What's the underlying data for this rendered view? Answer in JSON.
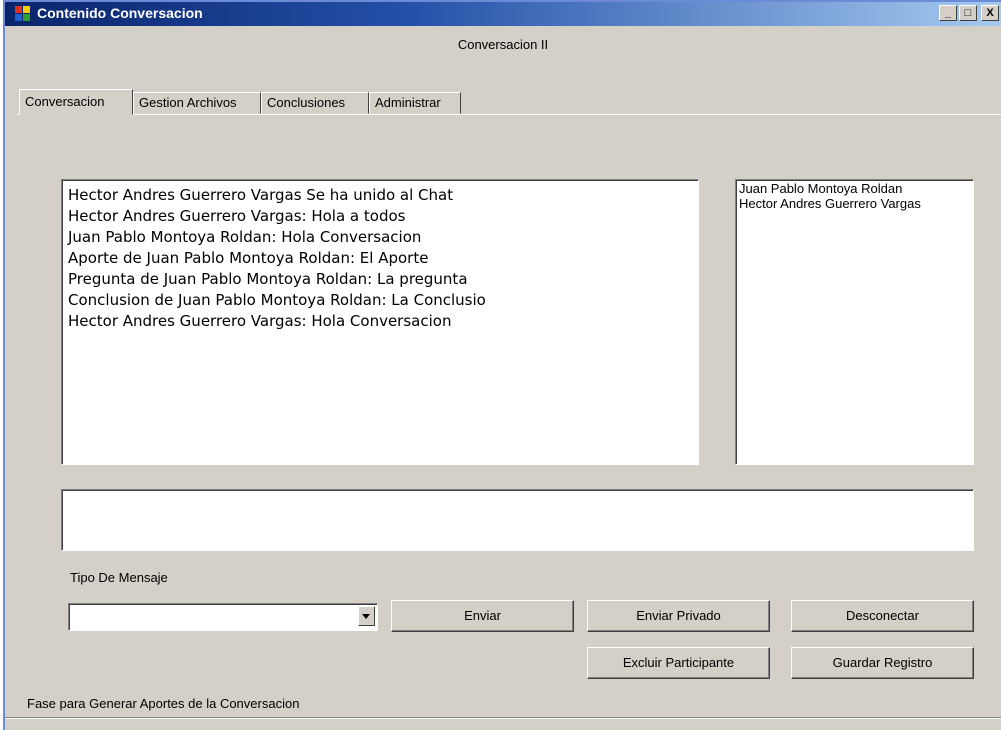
{
  "window": {
    "title": "Contenido Conversacion",
    "minimize_glyph": "_",
    "maximize_glyph": "□",
    "close_glyph": "X"
  },
  "header": {
    "subtitle": "Conversacion II"
  },
  "tabs": [
    {
      "label": "Conversacion",
      "active": true
    },
    {
      "label": "Gestion Archivos",
      "active": false
    },
    {
      "label": "Conclusiones",
      "active": false
    },
    {
      "label": "Administrar",
      "active": false
    }
  ],
  "chat": {
    "messages": [
      "Hector Andres Guerrero Vargas Se ha unido al Chat",
      "Hector Andres Guerrero Vargas: Hola a todos",
      "Juan Pablo Montoya Roldan: Hola Conversacion",
      "Aporte de Juan Pablo Montoya Roldan: El Aporte",
      "Pregunta de Juan Pablo Montoya Roldan: La pregunta",
      "Conclusion de Juan Pablo Montoya Roldan: La Conclusio",
      "Hector Andres Guerrero Vargas: Hola Conversacion"
    ]
  },
  "participants": [
    "Juan Pablo Montoya Roldan",
    "Hector Andres Guerrero Vargas"
  ],
  "message_input": {
    "value": ""
  },
  "tipo_mensaje": {
    "label": "Tipo De Mensaje",
    "selected": ""
  },
  "buttons": {
    "enviar": "Enviar",
    "enviar_privado": "Enviar Privado",
    "desconectar": "Desconectar",
    "excluir": "Excluir Participante",
    "guardar": "Guardar Registro"
  },
  "status": {
    "text": "Fase para Generar Aportes de la Conversacion"
  },
  "colors": {
    "titlebar_start": "#0a246a",
    "titlebar_end": "#a6caf0",
    "window_bg": "#d4d0c8"
  }
}
